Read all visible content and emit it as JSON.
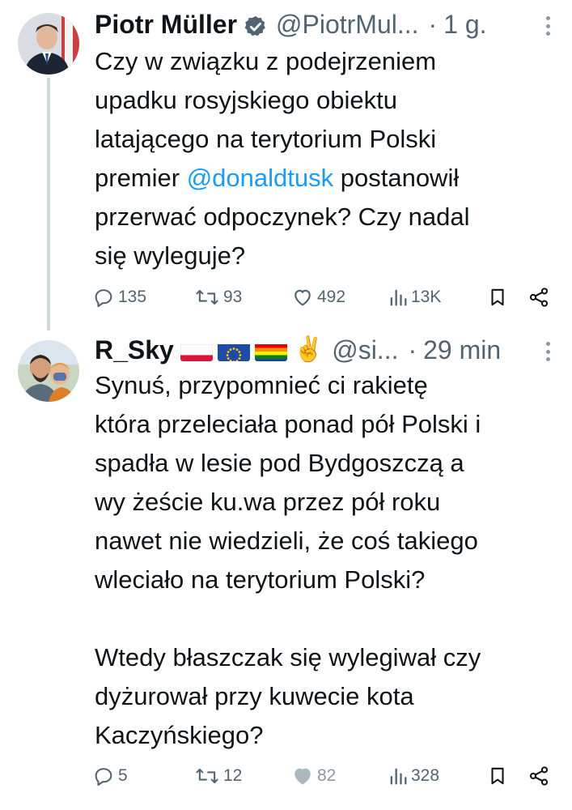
{
  "tweets": [
    {
      "author_name": "Piotr Müller",
      "verified": true,
      "handle": "@PiotrMul...",
      "separator": "·",
      "time": "1 g.",
      "text_lines": [
        "Czy w związku z podejrzeniem",
        "upadku rosyjskiego obiektu",
        "latającego na terytorium Polski"
      ],
      "text_line4_before": "premier ",
      "mention": "@donaldtusk",
      "text_line4_after": " postanowił",
      "text_lines_end": [
        "przerwać odpoczynek? Czy nadal",
        "się wyleguje?"
      ],
      "stats": {
        "replies": "135",
        "retweets": "93",
        "likes": "492",
        "views": "13K"
      }
    },
    {
      "author_name": "R_Sky",
      "emoji_suffix": "✌️",
      "handle": "@si...",
      "separator": "·",
      "time": "29 min",
      "paragraph1": [
        "Synuś, przypomnieć ci rakietę",
        "która przeleciała ponad pół Polski i",
        "spadła w lesie pod Bydgoszczą a",
        "wy żeście ku.wa przez pół roku",
        "nawet nie wiedzieli, że coś takiego",
        "wleciało na terytorium Polski?"
      ],
      "paragraph2": [
        "Wtedy błaszczak się wylegiwał czy",
        "dyżurował przy kuwecie kota",
        "Kaczyńskiego?"
      ],
      "stats": {
        "replies": "5",
        "retweets": "12",
        "likes": "82",
        "views": "328"
      }
    }
  ],
  "colors": {
    "text": "#0f1419",
    "secondary": "#536471",
    "link": "#1d9bf0",
    "thread_line": "#cfd9de",
    "liked_heart": "#aab8c2"
  },
  "icons": [
    "verified-badge-icon",
    "more-icon",
    "reply-icon",
    "retweet-icon",
    "like-icon",
    "views-icon",
    "bookmark-icon",
    "share-icon"
  ]
}
